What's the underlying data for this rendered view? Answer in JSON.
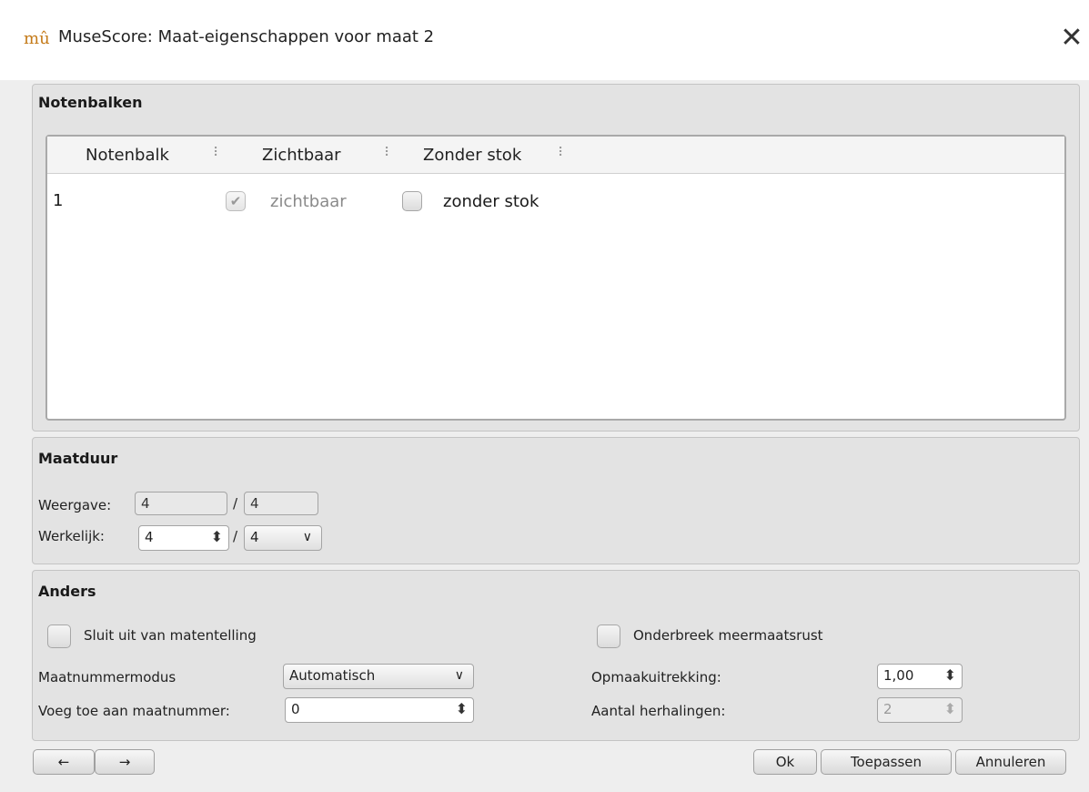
{
  "window": {
    "title": "MuseScore: Maat-eigenschappen voor maat 2",
    "app_icon_glyph": "mû",
    "close_glyph": "✕"
  },
  "staves": {
    "group_title": "Notenbalken",
    "columns": [
      "Notenbalk",
      "Zichtbaar",
      "Zonder stok"
    ],
    "column_separator_glyph": "⠇",
    "rows": [
      {
        "staff": "1",
        "visible_label": "zichtbaar",
        "visible_checked": true,
        "stemless_label": "zonder stok",
        "stemless_checked": false
      }
    ]
  },
  "duration": {
    "group_title": "Maatduur",
    "nominal_label": "Weergave:",
    "nominal_numerator": "4",
    "nominal_denominator": "4",
    "actual_label": "Werkelijk:",
    "actual_numerator": "4",
    "actual_denominator": "4",
    "slash": "/"
  },
  "other": {
    "group_title": "Anders",
    "exclude_label": "Sluit uit van matentelling",
    "exclude_checked": false,
    "break_mmrest_label": "Onderbreek meermaatsrust",
    "break_mmrest_checked": false,
    "number_mode_label": "Maatnummermodus",
    "number_mode_value": "Automatisch",
    "add_to_number_label": "Voeg toe aan maatnummer:",
    "add_to_number_value": "0",
    "layout_stretch_label": "Opmaakuitrekking:",
    "layout_stretch_value": "1,00",
    "repeat_count_label": "Aantal herhalingen:",
    "repeat_count_value": "2"
  },
  "buttons": {
    "prev": "←",
    "next": "→",
    "ok": "Ok",
    "apply": "Toepassen",
    "cancel": "Annuleren"
  },
  "glyphs": {
    "checkmark": "✔",
    "spin": "⬍",
    "chevron": "∨"
  }
}
